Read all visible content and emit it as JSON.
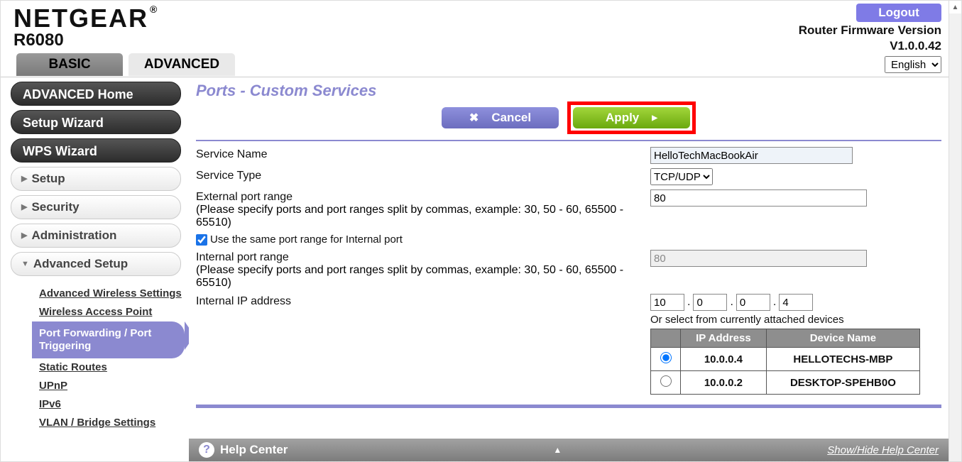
{
  "header": {
    "logo": "NETGEAR",
    "model": "R6080",
    "logout": "Logout",
    "fw_label": "Router Firmware Version",
    "fw_version": "V1.0.0.42"
  },
  "tabs": {
    "basic": "BASIC",
    "advanced": "ADVANCED",
    "language": "English"
  },
  "sidebar": {
    "adv_home": "ADVANCED Home",
    "setup_wizard": "Setup Wizard",
    "wps_wizard": "WPS Wizard",
    "setup": "Setup",
    "security": "Security",
    "administration": "Administration",
    "adv_setup": "Advanced Setup",
    "sub": {
      "adv_wireless": "Advanced Wireless Settings",
      "wap": "Wireless Access Point",
      "port_fwd": "Port Forwarding / Port Triggering",
      "static": "Static Routes",
      "upnp": "UPnP",
      "ipv6": "IPv6",
      "vlan": "VLAN / Bridge Settings"
    }
  },
  "panel": {
    "title": "Ports - Custom Services",
    "cancel": "Cancel",
    "apply": "Apply"
  },
  "form": {
    "service_name_label": "Service Name",
    "service_name_value": "HelloTechMacBookAir",
    "service_type_label": "Service Type",
    "service_type_value": "TCP/UDP",
    "ext_port_label": "External port range",
    "ext_port_value": "80",
    "port_note": "(Please specify ports and port ranges split by commas, example: 30, 50 - 60, 65500 - 65510)",
    "same_port_label": "Use the same port range for Internal port",
    "int_port_label": "Internal port range",
    "int_port_value": "80",
    "int_ip_label": "Internal IP address",
    "ip": [
      "10",
      "0",
      "0",
      "4"
    ],
    "or_text": "Or select from currently attached devices"
  },
  "dev_table": {
    "headers": [
      "",
      "IP Address",
      "Device Name"
    ],
    "rows": [
      {
        "selected": true,
        "ip": "10.0.0.4",
        "name": "HELLOTECHS-MBP"
      },
      {
        "selected": false,
        "ip": "10.0.0.2",
        "name": "DESKTOP-SPEHB0O"
      }
    ]
  },
  "help": {
    "title": "Help Center",
    "toggle": "Show/Hide Help Center"
  }
}
